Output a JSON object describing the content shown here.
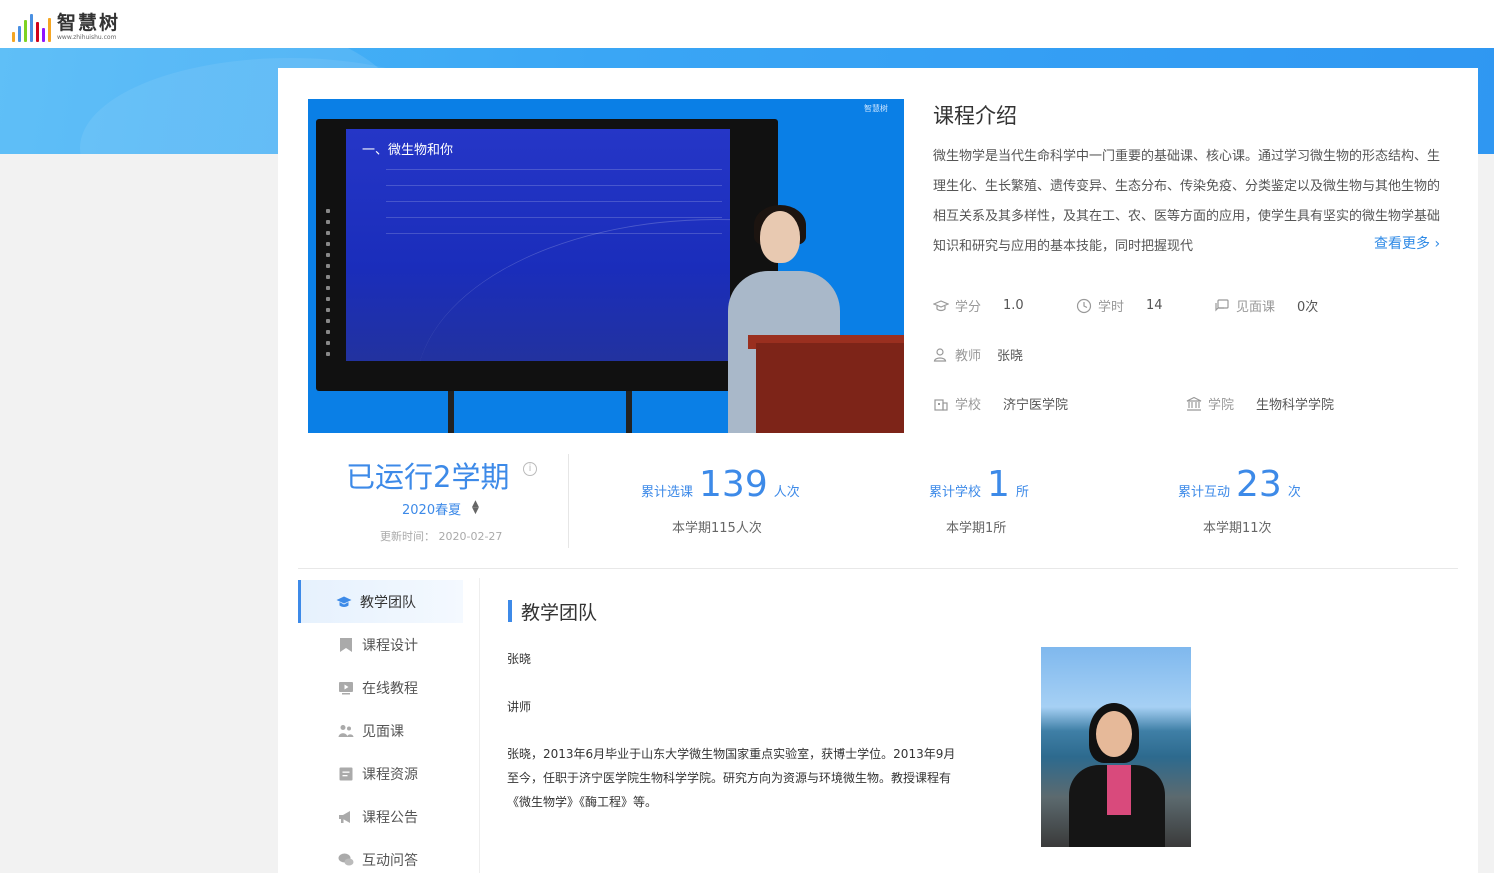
{
  "site": {
    "logo_text": "智慧树",
    "logo_sub": "www.zhihuishu.com",
    "logo_colors": [
      "#f5a623",
      "#4a90e2",
      "#7ed321",
      "#d0021b",
      "#9013fe",
      "#50e3c2",
      "#f8e71c"
    ]
  },
  "video": {
    "watermark": "智慧树",
    "slide_title": "一、微生物和你"
  },
  "intro": {
    "title": "课程介绍",
    "text": "微生物学是当代生命科学中一门重要的基础课、核心课。通过学习微生物的形态结构、生理生化、生长繁殖、遗传变异、生态分布、传染免疫、分类鉴定以及微生物与其他生物的相互关系及其多样性，及其在工、农、医等方面的应用，使学生具有坚实的微生物学基础知识和研究与应用的基本技能，同时把握现代",
    "more": "查看更多 ›"
  },
  "meta": {
    "credit_label": "学分",
    "credit": "1.0",
    "hours_label": "学时",
    "hours": "14",
    "meet_label": "见面课",
    "meet": "0次",
    "teacher_label": "教师",
    "teacher": "张晓",
    "school_label": "学校",
    "school": "济宁医学院",
    "college_label": "学院",
    "college": "生物科学学院"
  },
  "stats": {
    "run": "已运行2学期",
    "term": "2020春夏",
    "updated": "更新时间： 2020-02-27",
    "select_label": "累计选课",
    "select_num": "139",
    "select_unit": "人次",
    "select_sub": "本学期115人次",
    "school_label": "累计学校",
    "school_num": "1",
    "school_unit": "所",
    "school_sub": "本学期1所",
    "interact_label": "累计互动",
    "interact_num": "23",
    "interact_unit": "次",
    "interact_sub": "本学期11次"
  },
  "nav": {
    "items": [
      {
        "label": "教学团队",
        "icon": "graduation-cap-icon"
      },
      {
        "label": "课程设计",
        "icon": "bookmark-icon"
      },
      {
        "label": "在线教程",
        "icon": "video-icon"
      },
      {
        "label": "见面课",
        "icon": "people-icon"
      },
      {
        "label": "课程资源",
        "icon": "document-icon"
      },
      {
        "label": "课程公告",
        "icon": "megaphone-icon"
      },
      {
        "label": "互动问答",
        "icon": "chat-icon"
      }
    ]
  },
  "team": {
    "section_title": "教学团队",
    "name": "张晓",
    "title": "讲师",
    "bio": "张晓，2013年6月毕业于山东大学微生物国家重点实验室，获博士学位。2013年9月至今，任职于济宁医学院生物科学学院。研究方向为资源与环境微生物。教授课程有《微生物学》《酶工程》等。"
  }
}
